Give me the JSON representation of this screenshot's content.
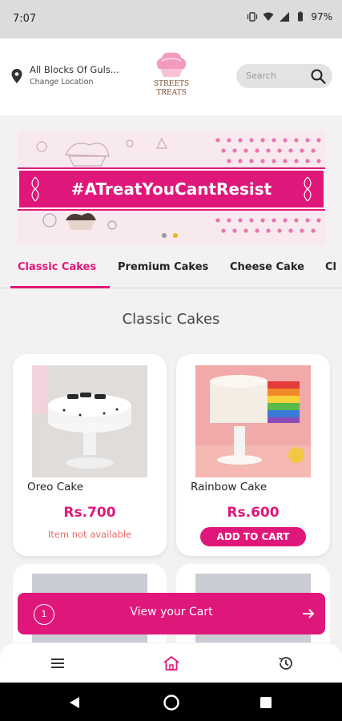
{
  "status_bar": {
    "time": "7:07",
    "battery": "97%"
  },
  "header": {
    "location": {
      "address": "All Blocks Of Guls...",
      "change": "Change Location"
    },
    "logo": {
      "line1": "STREETS",
      "line2": "TREATS"
    },
    "search": {
      "placeholder": "Search"
    }
  },
  "banner": {
    "tagline": "#ATreatYouCantResist",
    "active_slide": 2,
    "slide_count": 2
  },
  "tabs": [
    {
      "label": "Classic Cakes",
      "active": true
    },
    {
      "label": "Premium Cakes",
      "active": false
    },
    {
      "label": "Cheese Cake",
      "active": false
    },
    {
      "label": "Cl",
      "active": false
    }
  ],
  "section_title": "Classic Cakes",
  "products": [
    {
      "name": "Oreo Cake",
      "price": "Rs.700",
      "status": "Item not available"
    },
    {
      "name": "Rainbow Cake",
      "price": "Rs.600",
      "action": "ADD TO CART"
    }
  ],
  "cart_bar": {
    "count": "1",
    "label": "View your Cart"
  },
  "colors": {
    "accent": "#e0177a",
    "unavailable": "#e66a6a",
    "background": "#f3f1f2"
  },
  "bottom_nav": [
    {
      "icon": "menu-icon",
      "active": false
    },
    {
      "icon": "home-icon",
      "active": true
    },
    {
      "icon": "history-icon",
      "active": false
    }
  ]
}
